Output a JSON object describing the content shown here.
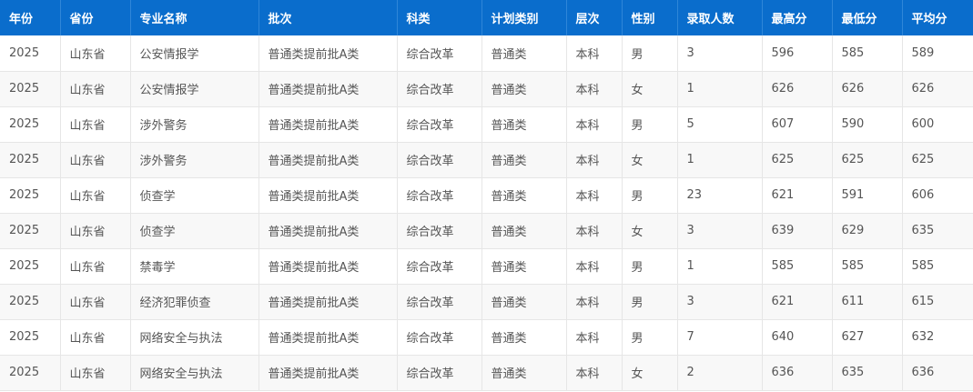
{
  "table": {
    "columns": [
      "年份",
      "省份",
      "专业名称",
      "批次",
      "科类",
      "计划类别",
      "层次",
      "性别",
      "录取人数",
      "最高分",
      "最低分",
      "平均分"
    ],
    "rows": [
      [
        "2025",
        "山东省",
        "公安情报学",
        "普通类提前批A类",
        "综合改革",
        "普通类",
        "本科",
        "男",
        "3",
        "596",
        "585",
        "589"
      ],
      [
        "2025",
        "山东省",
        "公安情报学",
        "普通类提前批A类",
        "综合改革",
        "普通类",
        "本科",
        "女",
        "1",
        "626",
        "626",
        "626"
      ],
      [
        "2025",
        "山东省",
        "涉外警务",
        "普通类提前批A类",
        "综合改革",
        "普通类",
        "本科",
        "男",
        "5",
        "607",
        "590",
        "600"
      ],
      [
        "2025",
        "山东省",
        "涉外警务",
        "普通类提前批A类",
        "综合改革",
        "普通类",
        "本科",
        "女",
        "1",
        "625",
        "625",
        "625"
      ],
      [
        "2025",
        "山东省",
        "侦查学",
        "普通类提前批A类",
        "综合改革",
        "普通类",
        "本科",
        "男",
        "23",
        "621",
        "591",
        "606"
      ],
      [
        "2025",
        "山东省",
        "侦查学",
        "普通类提前批A类",
        "综合改革",
        "普通类",
        "本科",
        "女",
        "3",
        "639",
        "629",
        "635"
      ],
      [
        "2025",
        "山东省",
        "禁毒学",
        "普通类提前批A类",
        "综合改革",
        "普通类",
        "本科",
        "男",
        "1",
        "585",
        "585",
        "585"
      ],
      [
        "2025",
        "山东省",
        "经济犯罪侦查",
        "普通类提前批A类",
        "综合改革",
        "普通类",
        "本科",
        "男",
        "3",
        "621",
        "611",
        "615"
      ],
      [
        "2025",
        "山东省",
        "网络安全与执法",
        "普通类提前批A类",
        "综合改革",
        "普通类",
        "本科",
        "男",
        "7",
        "640",
        "627",
        "632"
      ],
      [
        "2025",
        "山东省",
        "网络安全与执法",
        "普通类提前批A类",
        "综合改革",
        "普通类",
        "本科",
        "女",
        "2",
        "636",
        "635",
        "636"
      ]
    ]
  },
  "colors": {
    "header_bg": "#0a6dcc",
    "header_text": "#ffffff",
    "row_alt_bg": "#f8f8f8",
    "cell_text": "#555555",
    "border": "#e6e6e6"
  }
}
